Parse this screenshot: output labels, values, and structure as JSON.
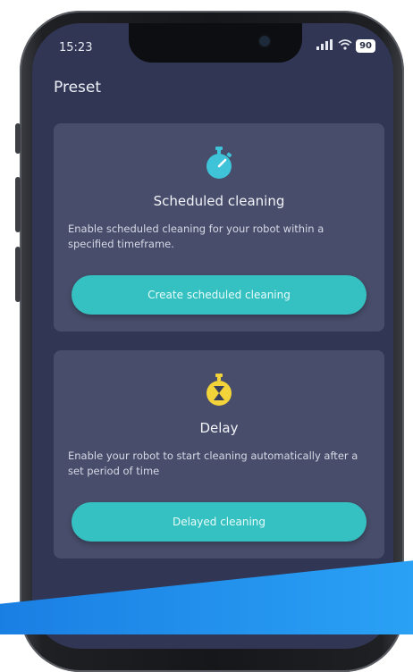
{
  "status_bar": {
    "time": "15:23",
    "signal_icon": "signal-icon",
    "wifi_icon": "wifi-icon",
    "battery_level": "90"
  },
  "header": {
    "title": "Preset"
  },
  "cards": [
    {
      "icon": "stopwatch-icon",
      "icon_color": "#3fc3d8",
      "title": "Scheduled cleaning",
      "description": "Enable scheduled cleaning for your robot within a specified timeframe.",
      "button_label": "Create scheduled cleaning"
    },
    {
      "icon": "hourglass-timer-icon",
      "icon_color": "#f3d33a",
      "title": "Delay",
      "description": "Enable your robot to start cleaning automatically after a set period of time",
      "button_label": "Delayed cleaning"
    }
  ],
  "colors": {
    "screen_bg": "#303654",
    "card_bg": "#474d6a",
    "accent": "#35c1c1",
    "brand_blue": "#1a7fe3"
  }
}
